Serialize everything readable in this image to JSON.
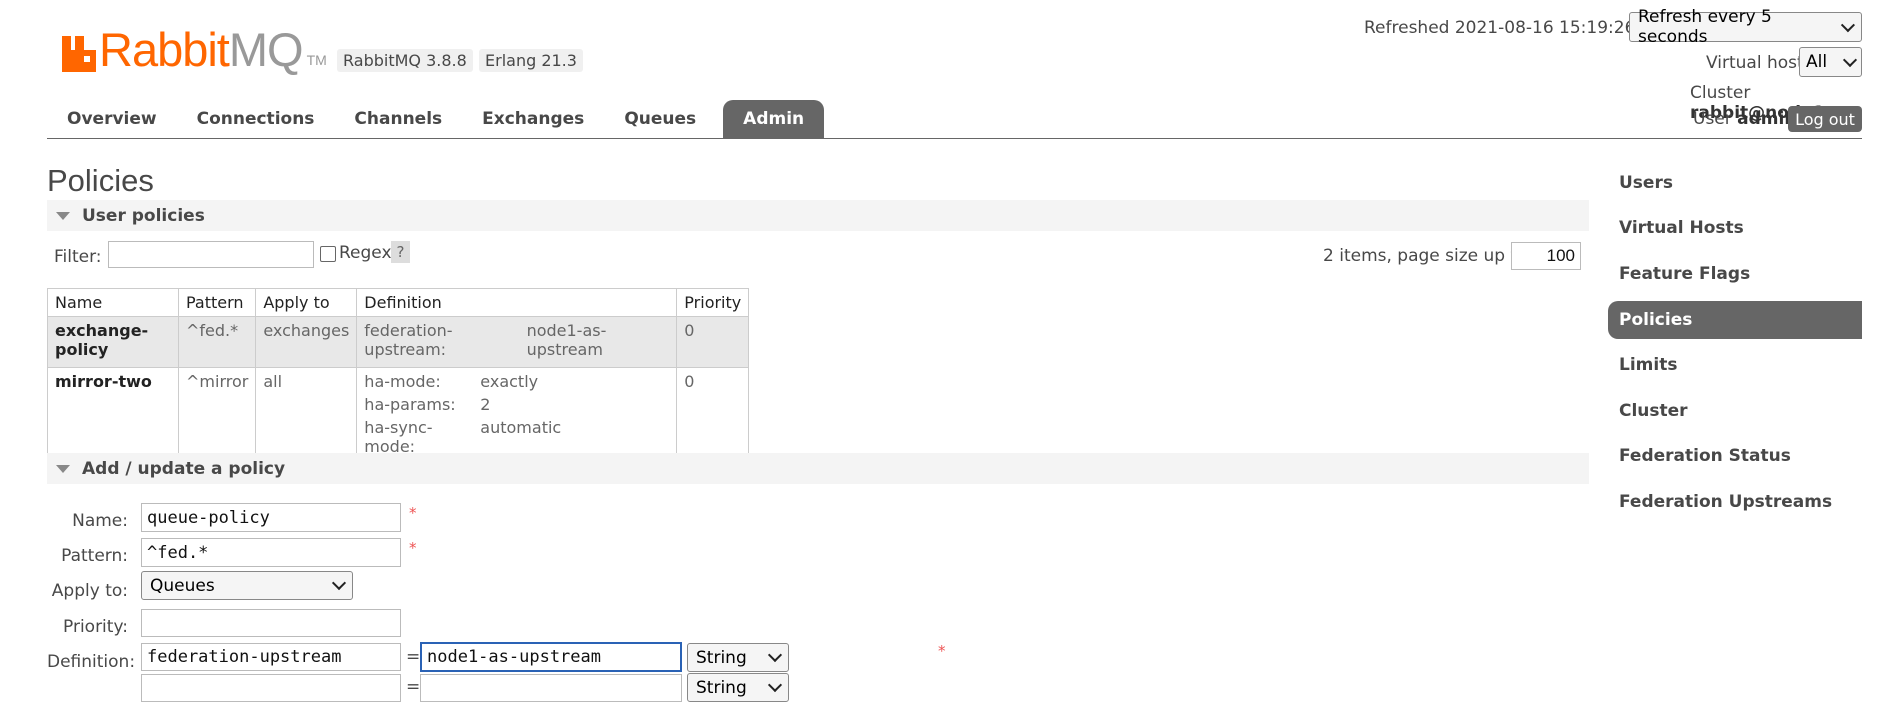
{
  "header": {
    "logo_brand": "Rabbit",
    "logo_mq": "MQ",
    "logo_tm": "TM",
    "version_badge": "RabbitMQ 3.8.8",
    "erlang_badge": "Erlang 21.3",
    "refreshed_text": "Refreshed 2021-08-16 15:19:26",
    "refresh_select": "Refresh every 5 seconds",
    "vhost_label": "Virtual host",
    "vhost_select": "All",
    "cluster_label": "Cluster",
    "cluster_value": "rabbit@node1",
    "user_label": "User",
    "user_value": "admin",
    "logout_label": "Log out",
    "brand_color": "#ff6600"
  },
  "tabs": [
    {
      "label": "Overview"
    },
    {
      "label": "Connections"
    },
    {
      "label": "Channels"
    },
    {
      "label": "Exchanges"
    },
    {
      "label": "Queues"
    },
    {
      "label": "Admin",
      "active": true
    }
  ],
  "sidebar": {
    "items": [
      {
        "label": "Users"
      },
      {
        "label": "Virtual Hosts"
      },
      {
        "label": "Feature Flags"
      },
      {
        "label": "Policies",
        "active": true
      },
      {
        "label": "Limits"
      },
      {
        "label": "Cluster"
      },
      {
        "label": "Federation Status"
      },
      {
        "label": "Federation Upstreams"
      }
    ]
  },
  "page": {
    "title": "Policies",
    "user_policies_section": "User policies",
    "filter_label": "Filter:",
    "filter_value": "",
    "regex_label": "Regex",
    "help_label": "?",
    "items_text": "2 items, page size up to",
    "page_size": "100"
  },
  "policies_table": {
    "headers": [
      "Name",
      "Pattern",
      "Apply to",
      "Definition",
      "Priority"
    ],
    "rows": [
      {
        "name": "exchange-policy",
        "pattern": "^fed.*",
        "apply_to": "exchanges",
        "definition": [
          {
            "key": "federation-upstream:",
            "value": "node1-as-upstream"
          }
        ],
        "priority": "0"
      },
      {
        "name": "mirror-two",
        "pattern": "^mirror",
        "apply_to": "all",
        "definition": [
          {
            "key": "ha-mode:",
            "value": "exactly"
          },
          {
            "key": "ha-params:",
            "value": "2"
          },
          {
            "key": "ha-sync-mode:",
            "value": "automatic"
          }
        ],
        "priority": "0"
      }
    ]
  },
  "add_form": {
    "section_title": "Add / update a policy",
    "name_label": "Name:",
    "name_value": "queue-policy",
    "pattern_label": "Pattern:",
    "pattern_value": "^fed.*",
    "apply_label": "Apply to:",
    "apply_value": "Queues",
    "priority_label": "Priority:",
    "priority_value": "",
    "definition_label": "Definition:",
    "required_mark": "*",
    "equals": "=",
    "definition_rows": [
      {
        "key": "federation-upstream",
        "value": "node1-as-upstream",
        "type": "String"
      },
      {
        "key": "",
        "value": "",
        "type": "String"
      }
    ]
  }
}
